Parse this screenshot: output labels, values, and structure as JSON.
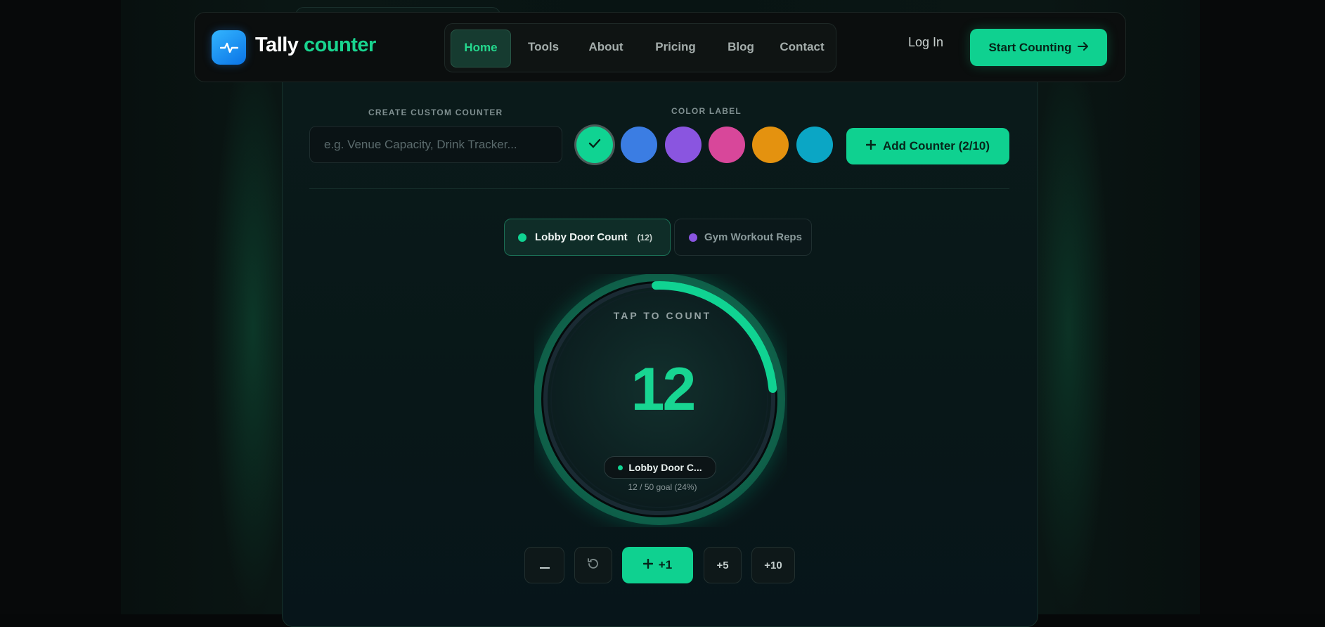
{
  "app": {
    "brand_word1": "Tally",
    "brand_word2": "counter",
    "logo_icon": "pulse-icon"
  },
  "nav": {
    "items": [
      {
        "label": "Home",
        "active": true
      },
      {
        "label": "Tools",
        "active": false
      },
      {
        "label": "About",
        "active": false
      },
      {
        "label": "Pricing",
        "active": false
      },
      {
        "label": "Blog",
        "active": false
      },
      {
        "label": "Contact",
        "active": false
      }
    ],
    "login_label": "Log In",
    "cta_label": "Start Counting"
  },
  "create": {
    "heading": "CREATE CUSTOM COUNTER",
    "placeholder": "e.g. Venue Capacity, Drink Tracker...",
    "color_heading": "COLOR LABEL",
    "colors": [
      "#10d392",
      "#3b7de3",
      "#8a55e0",
      "#d8479a",
      "#e4920f",
      "#0ba6c5"
    ],
    "selected_color_index": 0,
    "add_label": "Add Counter (2/10)"
  },
  "counters": [
    {
      "name": "Lobby Door Count",
      "count_label": "(12)",
      "color": "#10d392",
      "active": true
    },
    {
      "name": "Gym Workout Reps",
      "color": "#8a55e0",
      "active": false
    }
  ],
  "dial": {
    "prompt": "TAP TO COUNT",
    "value": "12",
    "name_short": "Lobby Door C...",
    "goal_text": "12 / 50 goal (24%)",
    "progress": 0.24
  },
  "controls": {
    "decrement_label": "−",
    "plus_one_label": "+1",
    "plus_five_label": "+5",
    "plus_ten_label": "+10"
  },
  "colors": {
    "accent": "#10d392",
    "background": "#060809"
  }
}
